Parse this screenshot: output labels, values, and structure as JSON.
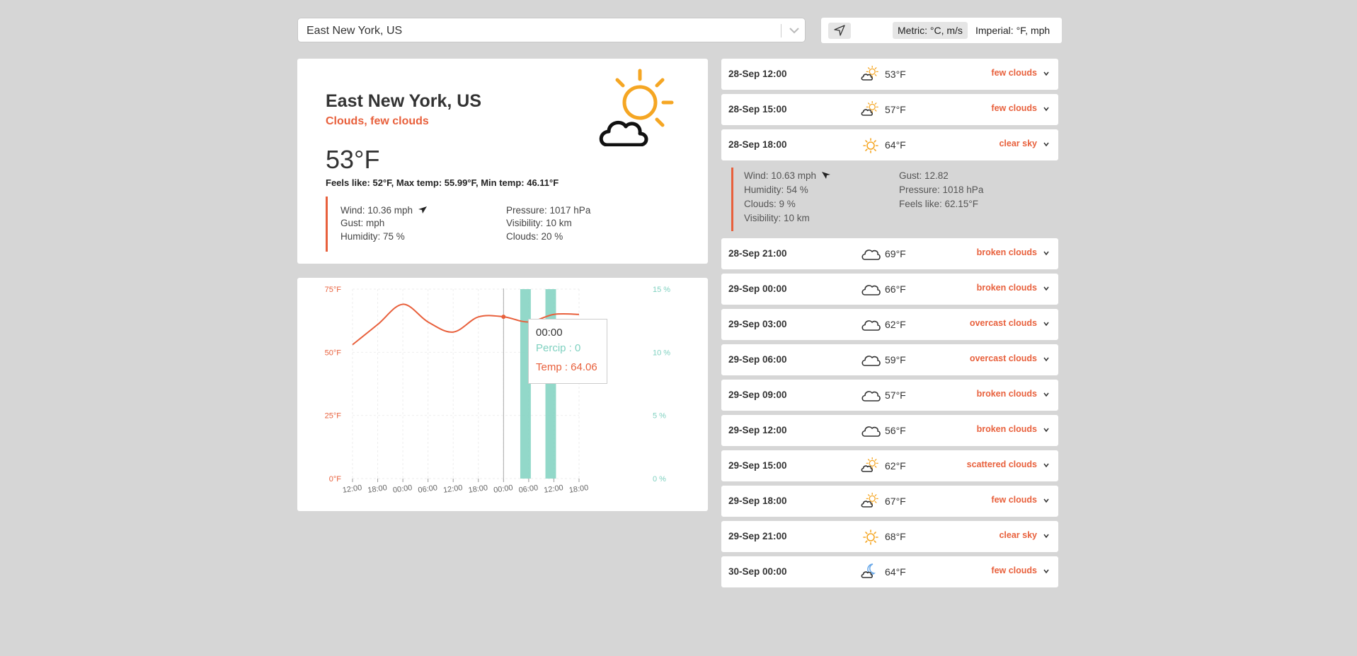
{
  "search": {
    "value": "East New York, US",
    "dropdown_icon": "chevron-down-icon"
  },
  "controls": {
    "location_icon": "navigation-arrow-icon",
    "metric_label": "Metric: °C, m/s",
    "imperial_label": "Imperial: °F, mph"
  },
  "current": {
    "city": "East New York, US",
    "condition": "Clouds, few clouds",
    "temperature": "53°F",
    "feels_line": "Feels like: 52°F, Max temp: 55.99°F, Min temp: 46.11°F",
    "wind": "Wind: 10.36 mph",
    "gust": "Gust: mph",
    "humidity": "Humidity: 75 %",
    "pressure": "Pressure: 1017 hPa",
    "visibility": "Visibility: 10 km",
    "clouds": "Clouds: 20 %",
    "icon": "sun-behind-cloud-icon",
    "colors": {
      "accent": "#e8603c",
      "sun": "#f5a623",
      "precip": "#7fd1c0"
    }
  },
  "chart_data": {
    "type": "line",
    "x": [
      "12:00",
      "18:00",
      "00:00",
      "06:00",
      "12:00",
      "18:00",
      "00:00",
      "06:00",
      "12:00",
      "18:00"
    ],
    "series": [
      {
        "name": "Temp",
        "axis": "left",
        "values": [
          53,
          61,
          69,
          62,
          58,
          64,
          64.06,
          62,
          65,
          65
        ]
      },
      {
        "name": "Percip",
        "axis": "right",
        "type": "bar",
        "values": [
          0,
          0,
          0,
          0,
          0,
          0,
          0,
          15,
          15,
          0
        ]
      }
    ],
    "left_ticks": [
      "0°F",
      "25°F",
      "50°F",
      "75°F"
    ],
    "right_ticks": [
      "0 %",
      "5 %",
      "10 %",
      "15 %"
    ],
    "ylim_left": [
      0,
      75
    ],
    "ylim_right": [
      0,
      15
    ],
    "grid": true,
    "tooltip": {
      "time": "00:00",
      "percip": "Percip : 0",
      "temp": "Temp : 64.06"
    }
  },
  "forecast": [
    {
      "datetime": "28-Sep 12:00",
      "temp": "53°F",
      "desc": "few clouds",
      "icon": "sun-cloud-icon"
    },
    {
      "datetime": "28-Sep 15:00",
      "temp": "57°F",
      "desc": "few clouds",
      "icon": "sun-cloud-icon"
    },
    {
      "datetime": "28-Sep 18:00",
      "temp": "64°F",
      "desc": "clear sky",
      "icon": "sun-icon"
    },
    {
      "datetime": "28-Sep 21:00",
      "temp": "69°F",
      "desc": "broken clouds",
      "icon": "cloud-icon"
    },
    {
      "datetime": "29-Sep 00:00",
      "temp": "66°F",
      "desc": "broken clouds",
      "icon": "cloud-icon"
    },
    {
      "datetime": "29-Sep 03:00",
      "temp": "62°F",
      "desc": "overcast clouds",
      "icon": "cloud-icon"
    },
    {
      "datetime": "29-Sep 06:00",
      "temp": "59°F",
      "desc": "overcast clouds",
      "icon": "cloud-icon"
    },
    {
      "datetime": "29-Sep 09:00",
      "temp": "57°F",
      "desc": "broken clouds",
      "icon": "cloud-icon"
    },
    {
      "datetime": "29-Sep 12:00",
      "temp": "56°F",
      "desc": "broken clouds",
      "icon": "cloud-icon"
    },
    {
      "datetime": "29-Sep 15:00",
      "temp": "62°F",
      "desc": "scattered clouds",
      "icon": "sun-cloud-icon"
    },
    {
      "datetime": "29-Sep 18:00",
      "temp": "67°F",
      "desc": "few clouds",
      "icon": "sun-cloud-icon"
    },
    {
      "datetime": "29-Sep 21:00",
      "temp": "68°F",
      "desc": "clear sky",
      "icon": "sun-icon"
    },
    {
      "datetime": "30-Sep 00:00",
      "temp": "64°F",
      "desc": "few clouds",
      "icon": "moon-cloud-icon"
    }
  ],
  "expanded_details": {
    "wind": "Wind: 10.63 mph",
    "humidity": "Humidity: 54 %",
    "clouds": "Clouds: 9 %",
    "visibility": "Visibility: 10 km",
    "gust": "Gust: 12.82",
    "pressure": "Pressure: 1018 hPa",
    "feels_like": "Feels like: 62.15°F"
  }
}
